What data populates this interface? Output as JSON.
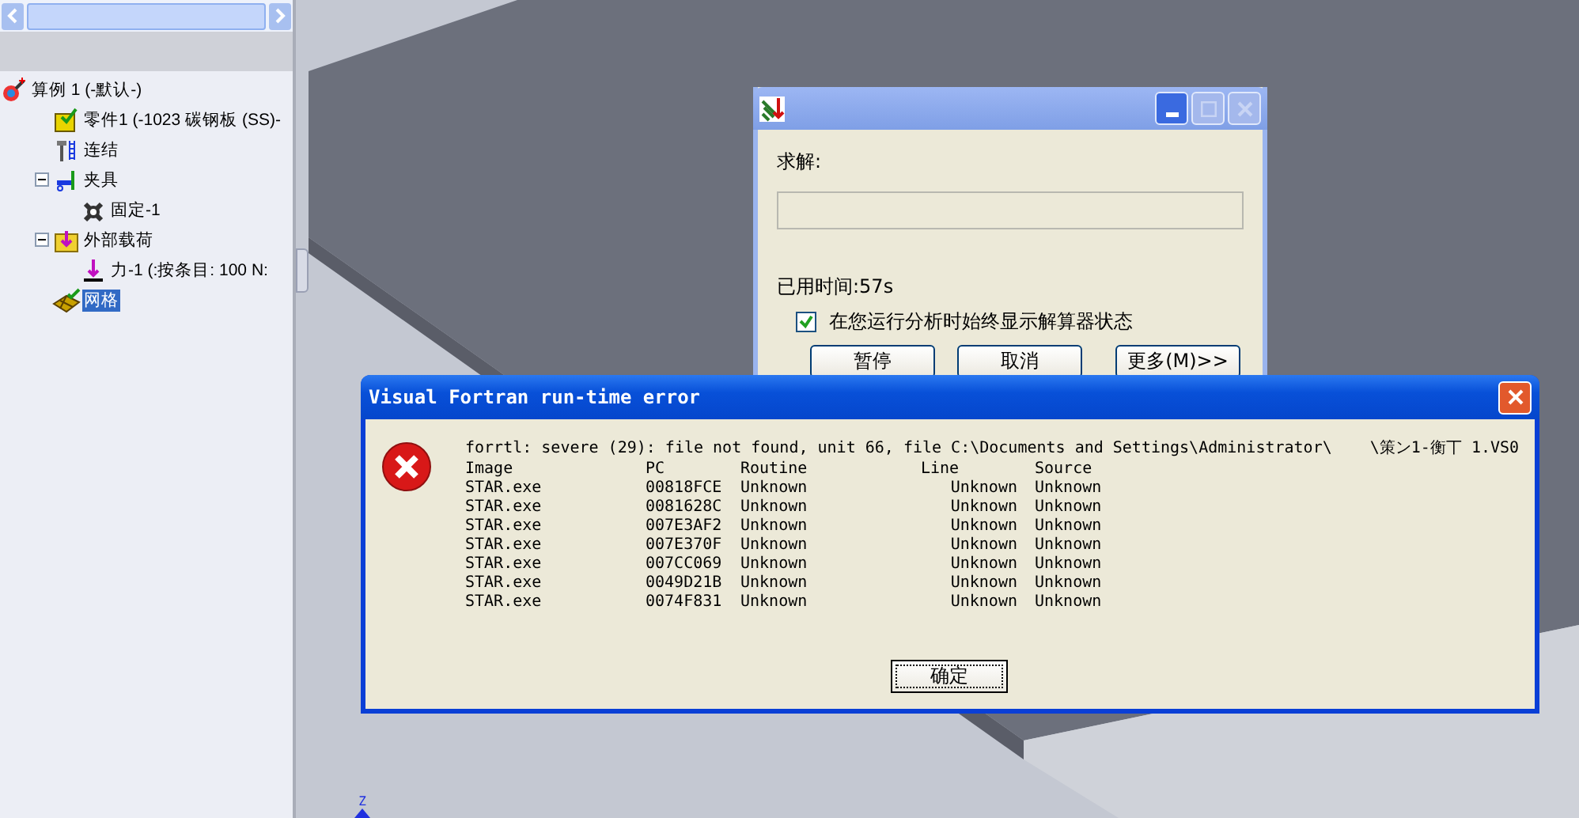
{
  "tree_panel": {
    "items": [
      {
        "label": "算例 1 (-默认-)",
        "kind": "study",
        "selected": false,
        "children": [
          {
            "label": "零件1 (-1023 碳钢板 (SS)-",
            "kind": "part",
            "selected": false
          },
          {
            "label": "连结",
            "kind": "connection",
            "selected": false
          },
          {
            "label": "夹具",
            "kind": "fixture",
            "selected": false,
            "expanded": true,
            "children": [
              {
                "label": "固定-1",
                "kind": "fixed",
                "selected": false
              }
            ]
          },
          {
            "label": "外部载荷",
            "kind": "loads",
            "selected": false,
            "expanded": true,
            "children": [
              {
                "label": "力-1 (:按条目: 100 N:",
                "kind": "force",
                "selected": false
              }
            ]
          },
          {
            "label": "网格",
            "kind": "mesh",
            "selected": true
          }
        ]
      }
    ]
  },
  "viewport": {
    "axis_label": "Z"
  },
  "solver_dialog": {
    "label": "求解:",
    "progress": {
      "level": 0
    },
    "elapsed": "已用时间:57s",
    "checkbox": {
      "label": "在您运行分析时始终显示解算器状态",
      "checked": true
    },
    "buttons": [
      "暂停",
      "取消",
      "更多(M)>>"
    ]
  },
  "error_dialog": {
    "title": "Visual Fortran run-time error",
    "message": "forrtl: severe (29): file not found, unit 66, file C:\\Documents and Settings\\Administrator\\",
    "message_tail": "\\策ン1-衡丅 1.VS0",
    "columns": [
      "Image",
      "PC",
      "Routine",
      "Line",
      "Source"
    ],
    "rows": [
      [
        "STAR.exe",
        "00818FCE",
        "Unknown",
        "Unknown",
        "Unknown"
      ],
      [
        "STAR.exe",
        "0081628C",
        "Unknown",
        "Unknown",
        "Unknown"
      ],
      [
        "STAR.exe",
        "007E3AF2",
        "Unknown",
        "Unknown",
        "Unknown"
      ],
      [
        "STAR.exe",
        "007E370F",
        "Unknown",
        "Unknown",
        "Unknown"
      ],
      [
        "STAR.exe",
        "007CC069",
        "Unknown",
        "Unknown",
        "Unknown"
      ],
      [
        "STAR.exe",
        "0049D21B",
        "Unknown",
        "Unknown",
        "Unknown"
      ],
      [
        "STAR.exe",
        "0074F831",
        "Unknown",
        "Unknown",
        "Unknown"
      ]
    ],
    "button": "确定"
  }
}
